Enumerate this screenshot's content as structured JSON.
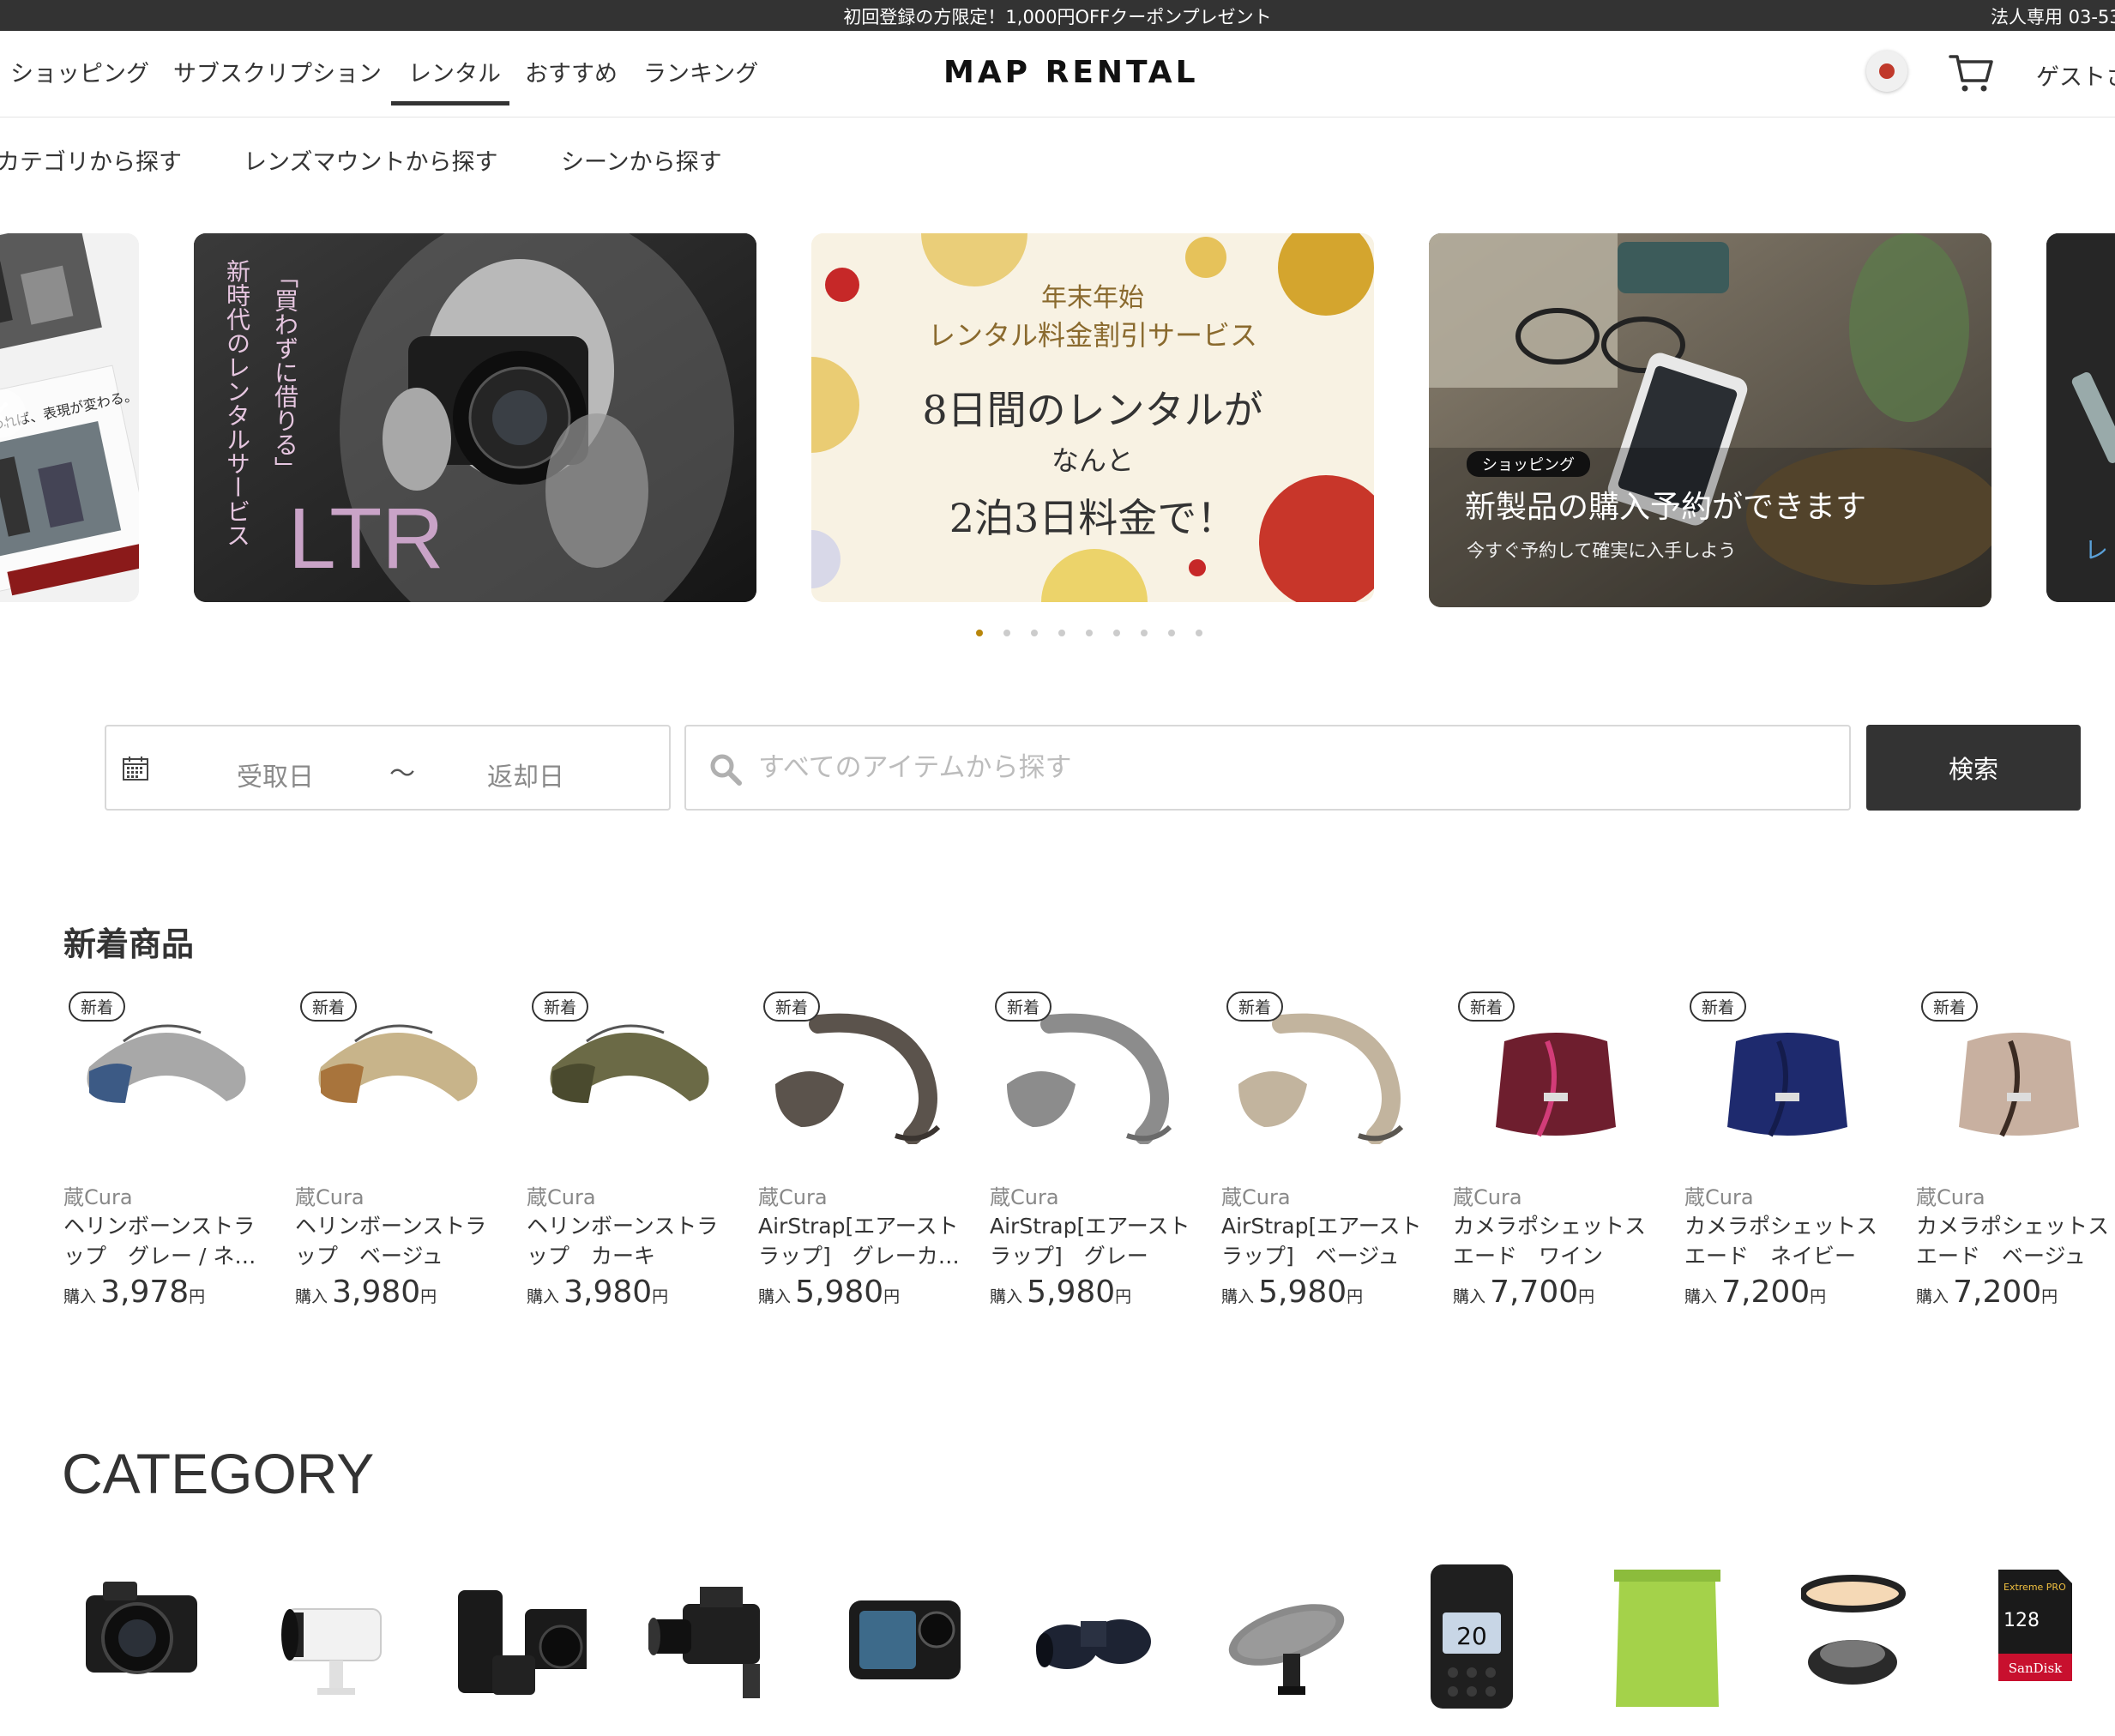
{
  "announcement": {
    "center": "初回登録の方限定！1,000円OFFクーポンプレゼント",
    "right": "法人専用 03-53"
  },
  "header": {
    "nav": [
      "ショッピング",
      "サブスクリプション",
      "レンタル",
      "おすすめ",
      "ランキング"
    ],
    "active_nav": "レンタル",
    "logo": "MAP RENTAL",
    "guest": "ゲストさ"
  },
  "subnav": [
    "カテゴリから探す",
    "レンズマウントから探す",
    "シーンから探す"
  ],
  "banners": {
    "slide0": {
      "caption": "変われば、表現が変わる。"
    },
    "slide1": {
      "vertical1": "「買わずに借りる」",
      "vertical2": "新時代のレンタルサービス",
      "big": "LTR"
    },
    "slide2": {
      "line1": "年末年始",
      "line2": "レンタル料金割引サービス",
      "line3": "8日間のレンタルが",
      "line4": "なんと",
      "line5": "2泊3日料金で！"
    },
    "slide3": {
      "tag": "ショッピング",
      "title": "新製品の購入予約ができます",
      "subtitle": "今すぐ予約して確実に入手しよう"
    },
    "slide4": {
      "text": "レ"
    },
    "dot_count": 9,
    "active_dot": 0
  },
  "search": {
    "start_placeholder": "受取日",
    "separator": "〜",
    "end_placeholder": "返却日",
    "placeholder": "すべてのアイテムから探す",
    "button": "検索"
  },
  "new_arrivals": {
    "title": "新着商品",
    "badge": "新着",
    "price_label": "購入",
    "yen": "円",
    "items": [
      {
        "brand": "蔵Cura",
        "name": "ヘリンボーンストラップ　グレー / ネイビー",
        "price": "3,978",
        "color_a": "#a8a8a8",
        "color_b": "#3c5a85"
      },
      {
        "brand": "蔵Cura",
        "name": "ヘリンボーンストラップ　ベージュ",
        "price": "3,980",
        "color_a": "#c8b48a",
        "color_b": "#a8743c"
      },
      {
        "brand": "蔵Cura",
        "name": "ヘリンボーンストラップ　カーキ",
        "price": "3,980",
        "color_a": "#6b6a46",
        "color_b": "#4a4a2e"
      },
      {
        "brand": "蔵Cura",
        "name": "AirStrap[エアーストラップ]　グレーカーキ",
        "price": "5,980",
        "color_a": "#5b534c",
        "color_b": "#3a3430"
      },
      {
        "brand": "蔵Cura",
        "name": "AirStrap[エアーストラップ]　グレー",
        "price": "5,980",
        "color_a": "#8c8c8c",
        "color_b": "#6a6a6a"
      },
      {
        "brand": "蔵Cura",
        "name": "AirStrap[エアーストラップ]　ベージュ",
        "price": "5,980",
        "color_a": "#c2b49e",
        "color_b": "#5a5650"
      },
      {
        "brand": "蔵Cura",
        "name": "カメラポシェットスエード　ワイン",
        "price": "7,700",
        "color_a": "#6e1e2e",
        "color_b": "#d23c78"
      },
      {
        "brand": "蔵Cura",
        "name": "カメラポシェットスエード　ネイビー",
        "price": "7,200",
        "color_a": "#1e2a6e",
        "color_b": "#141c4c"
      },
      {
        "brand": "蔵Cura",
        "name": "カメラポシェットスエード　ベージュ",
        "price": "7,200",
        "color_a": "#c8b0a0",
        "color_b": "#3a2a22"
      }
    ]
  },
  "category": {
    "title": "CATEGORY",
    "items": [
      "camera-icon",
      "lens-icon",
      "mirrorless-kit-icon",
      "video-camera-icon",
      "action-camera-icon",
      "binoculars-icon",
      "microphone-icon",
      "transceiver-icon",
      "backdrop-icon",
      "filter-icon",
      "sd-card-icon"
    ],
    "transceiver_display": "20",
    "sd_brand": "SanDisk",
    "sd_capacity": "128",
    "sd_series": "Extreme PRO"
  }
}
